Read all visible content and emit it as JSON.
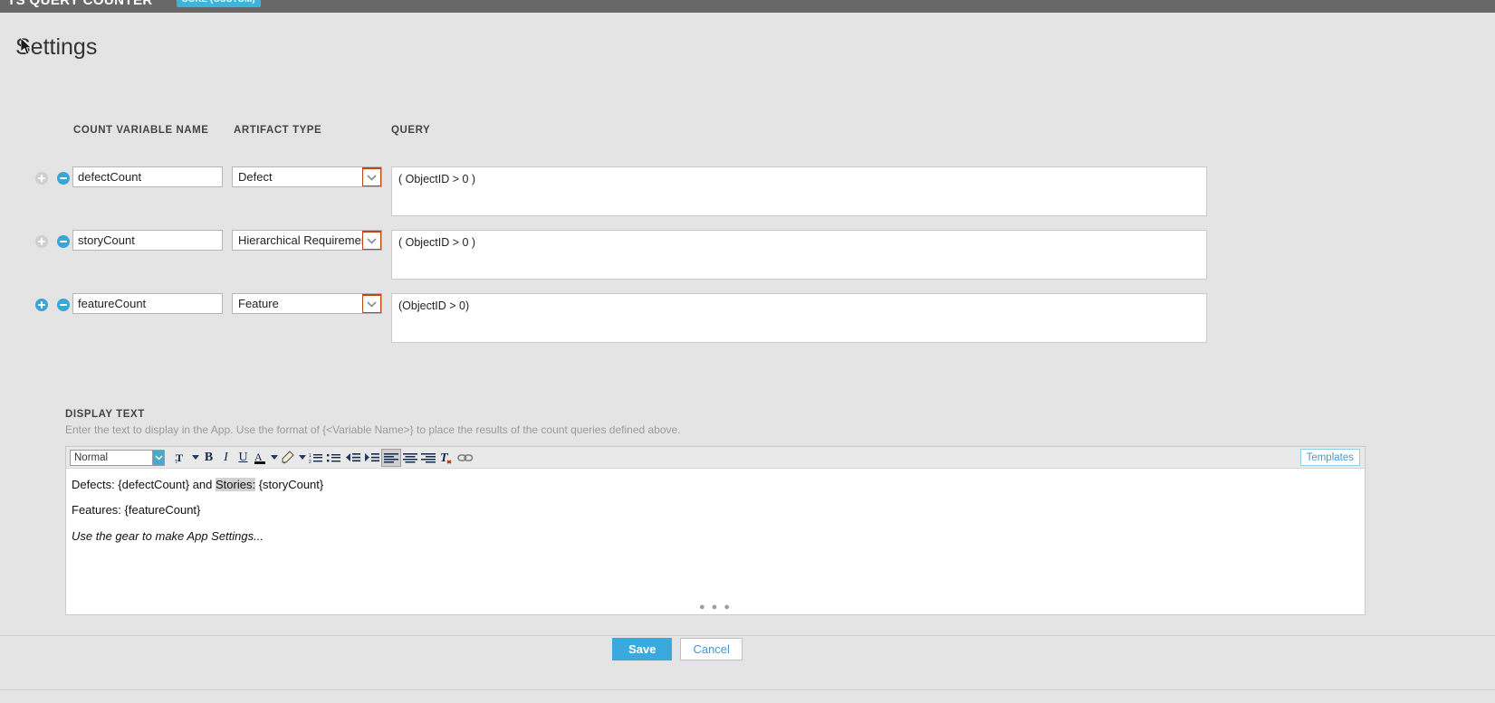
{
  "appbar": {
    "title": "TS QUERY COUNTER",
    "badge": "CORE (CUSTOM)",
    "bg_color": "#686868",
    "badge_color": "#3cb4dc"
  },
  "page": {
    "title": "Settings"
  },
  "count_table": {
    "headers": {
      "variable_name": "COUNT VARIABLE NAME",
      "artifact_type": "ARTIFACT TYPE",
      "query": "QUERY"
    },
    "rows": [
      {
        "add_icon": "plus-circle-icon",
        "add_enabled": false,
        "remove_icon": "minus-circle-icon",
        "remove_enabled": true,
        "variable_name": "defectCount",
        "variable_name_placeholder": "",
        "artifact_type": "Defect",
        "query": "( ObjectID > 0 )"
      },
      {
        "add_icon": "plus-circle-icon",
        "add_enabled": false,
        "remove_icon": "minus-circle-icon",
        "remove_enabled": true,
        "variable_name": "storyCount",
        "variable_name_placeholder": "",
        "artifact_type": "Hierarchical Requirement",
        "query": "( ObjectID > 0 )"
      },
      {
        "add_icon": "plus-circle-icon",
        "add_enabled": true,
        "remove_icon": "minus-circle-icon",
        "remove_enabled": true,
        "variable_name": "featureCount",
        "variable_name_placeholder": "",
        "artifact_type": "Feature",
        "query": "(ObjectID > 0)"
      }
    ]
  },
  "display_text": {
    "label": "DISPLAY TEXT",
    "help": "Enter the text to display in the App. Use the format of {<Variable Name>} to place the results of the count queries defined above.",
    "toolbar": {
      "style_value": "Normal",
      "style_options": [
        "Normal"
      ],
      "buttons": [
        {
          "name": "font-size-icon",
          "label": "T",
          "has_caret": true,
          "active": false
        },
        {
          "name": "bold-icon",
          "label": "B",
          "has_caret": false,
          "active": false
        },
        {
          "name": "italic-icon",
          "label": "I",
          "has_caret": false,
          "active": false
        },
        {
          "name": "underline-icon",
          "label": "U",
          "has_caret": false,
          "active": false
        },
        {
          "name": "font-color-icon",
          "label": "A",
          "has_caret": true,
          "active": false
        },
        {
          "name": "highlight-color-icon",
          "label": "",
          "has_caret": true,
          "active": false
        },
        {
          "name": "numbered-list-icon",
          "label": "",
          "has_caret": false,
          "active": false
        },
        {
          "name": "bulleted-list-icon",
          "label": "",
          "has_caret": false,
          "active": false
        },
        {
          "name": "outdent-icon",
          "label": "",
          "has_caret": false,
          "active": false
        },
        {
          "name": "indent-icon",
          "label": "",
          "has_caret": false,
          "active": false
        },
        {
          "name": "align-left-icon",
          "label": "",
          "has_caret": false,
          "active": true
        },
        {
          "name": "align-center-icon",
          "label": "",
          "has_caret": false,
          "active": false
        },
        {
          "name": "align-right-icon",
          "label": "",
          "has_caret": false,
          "active": false
        },
        {
          "name": "clear-formatting-icon",
          "label": "T",
          "has_caret": false,
          "active": false
        },
        {
          "name": "insert-link-icon",
          "label": "",
          "has_caret": false,
          "active": false
        }
      ],
      "templates_label": "Templates"
    },
    "content": {
      "line1_part1": "Defects: {defectCount} and ",
      "line1_selected": "Stories:",
      "line1_part2": " {storyCount}",
      "line2": "Features: {featureCount}",
      "line3": "Use the gear to make App Settings...",
      "resize_grip": "● ● ●"
    }
  },
  "footer": {
    "save_label": "Save",
    "cancel_label": "Cancel",
    "save_color": "#3aa9de",
    "cancel_color": "#3f9ad4"
  }
}
